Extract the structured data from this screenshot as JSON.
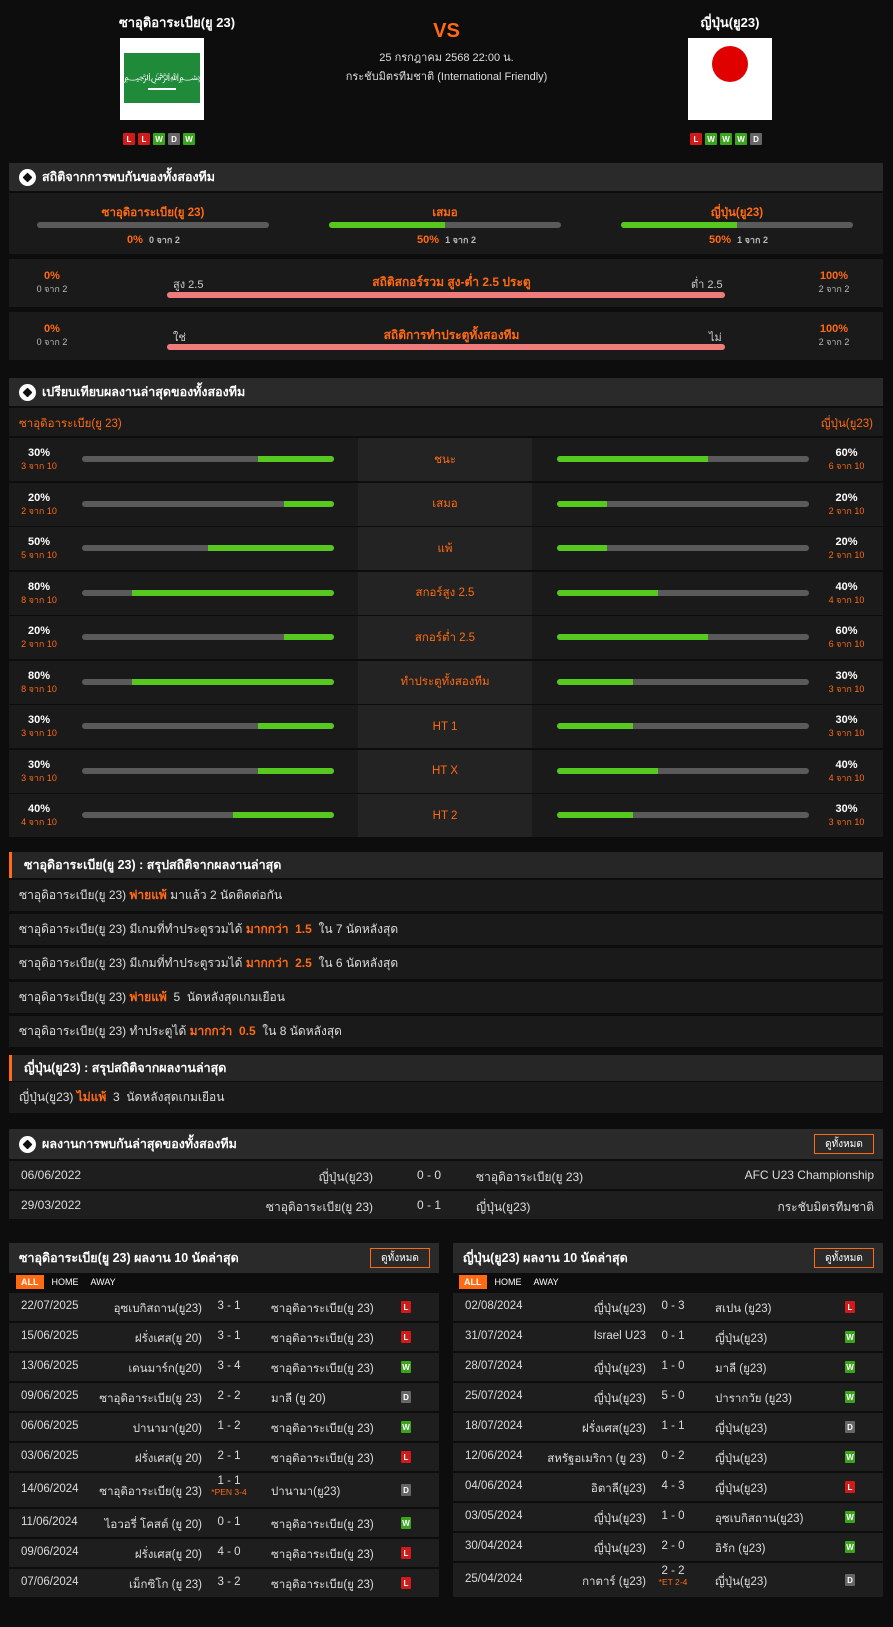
{
  "match": {
    "home_name": "ซาอุดิอาระเบีย(ยู 23)",
    "away_name": "ญี่ปุ่น(ยู23)",
    "vs": "VS",
    "date": "25 กรกฎาคม 2568 22:00 น.",
    "competition": "กระชับมิตรทีมชาติ (International Friendly)",
    "home_form": [
      "L",
      "L",
      "W",
      "D",
      "W"
    ],
    "away_form": [
      "L",
      "W",
      "W",
      "W",
      "D"
    ]
  },
  "h2h_stats": {
    "title": "สถิติจากการพบกันของทั้งสองทีม",
    "home": {
      "label": "ซาอุดิอาระเบีย(ยู 23)",
      "pct": "0%",
      "sub": "0 จาก 2",
      "value": 0
    },
    "draw": {
      "label": "เสมอ",
      "pct": "50%",
      "sub": "1 จาก 2",
      "value": 0.5
    },
    "away": {
      "label": "ญี่ปุ่น(ยู23)",
      "pct": "50%",
      "sub": "1 จาก 2",
      "value": 0.5
    },
    "ou": {
      "title": "สถิติสกอร์รวม สูง-ต่ำ 2.5 ประตู",
      "left_pct": "0%",
      "left_sub": "0 จาก 2",
      "left_label": "สูง 2.5",
      "right_label": "ต่ำ 2.5",
      "right_pct": "100%",
      "right_sub": "2 จาก 2"
    },
    "btts": {
      "title": "สถิติการทำประตูทั้งสองทีม",
      "left_pct": "0%",
      "left_sub": "0 จาก 2",
      "left_label": "ใช่",
      "right_label": "ไม่",
      "right_pct": "100%",
      "right_sub": "2 จาก 2"
    }
  },
  "compare": {
    "title": "เปรียบเทียบผลงานล่าสุดของทั้งสองทีม",
    "home_name": "ซาอุดิอาระเบีย(ยู 23)",
    "away_name": "ญี่ปุ่น(ยู23)",
    "rows": [
      {
        "label": "ชนะ",
        "hp": "30%",
        "hs": "3 จาก 10",
        "hv": 0.3,
        "ap": "60%",
        "as": "6 จาก 10",
        "av": 0.6
      },
      {
        "label": "เสมอ",
        "hp": "20%",
        "hs": "2 จาก 10",
        "hv": 0.2,
        "ap": "20%",
        "as": "2 จาก 10",
        "av": 0.2
      },
      {
        "label": "แพ้",
        "hp": "50%",
        "hs": "5 จาก 10",
        "hv": 0.5,
        "ap": "20%",
        "as": "2 จาก 10",
        "av": 0.2
      },
      {
        "label": "สกอร์สูง 2.5",
        "hp": "80%",
        "hs": "8 จาก 10",
        "hv": 0.8,
        "ap": "40%",
        "as": "4 จาก 10",
        "av": 0.4
      },
      {
        "label": "สกอร์ต่ำ 2.5",
        "hp": "20%",
        "hs": "2 จาก 10",
        "hv": 0.2,
        "ap": "60%",
        "as": "6 จาก 10",
        "av": 0.6
      },
      {
        "label": "ทำประตูทั้งสองทีม",
        "hp": "80%",
        "hs": "8 จาก 10",
        "hv": 0.8,
        "ap": "30%",
        "as": "3 จาก 10",
        "av": 0.3
      },
      {
        "label": "HT 1",
        "hp": "30%",
        "hs": "3 จาก 10",
        "hv": 0.3,
        "ap": "30%",
        "as": "3 จาก 10",
        "av": 0.3
      },
      {
        "label": "HT X",
        "hp": "30%",
        "hs": "3 จาก 10",
        "hv": 0.3,
        "ap": "40%",
        "as": "4 จาก 10",
        "av": 0.4
      },
      {
        "label": "HT 2",
        "hp": "40%",
        "hs": "4 จาก 10",
        "hv": 0.4,
        "ap": "30%",
        "as": "3 จาก 10",
        "av": 0.3
      }
    ]
  },
  "home_summary": {
    "title": "ซาอุดิอาระเบีย(ยู 23) : สรุปสถิติจากผลงานล่าสุด",
    "lines": [
      [
        {
          "t": "ซาอุดิอาระเบีย(ยู 23) "
        },
        {
          "t": "พ่ายแพ้",
          "o": 1
        },
        {
          "t": " มาแล้ว 2 นัดติดต่อกัน"
        }
      ],
      [
        {
          "t": "ซาอุดิอาระเบีย(ยู 23) มีเกมที่ทำประตูรวมได้ "
        },
        {
          "t": "มากกว่า  1.5",
          "o": 1
        },
        {
          "t": "  ใน 7 นัดหลังสุด"
        }
      ],
      [
        {
          "t": "ซาอุดิอาระเบีย(ยู 23) มีเกมที่ทำประตูรวมได้ "
        },
        {
          "t": "มากกว่า  2.5",
          "o": 1
        },
        {
          "t": "  ใน 6 นัดหลังสุด"
        }
      ],
      [
        {
          "t": "ซาอุดิอาระเบีย(ยู 23) "
        },
        {
          "t": "พ่ายแพ้",
          "o": 1
        },
        {
          "t": "  5  นัดหลังสุดเกมเยือน"
        }
      ],
      [
        {
          "t": "ซาอุดิอาระเบีย(ยู 23) ทำประตูได้ "
        },
        {
          "t": "มากกว่า  0.5",
          "o": 1
        },
        {
          "t": "  ใน 8 นัดหลังสุด"
        }
      ]
    ]
  },
  "away_summary": {
    "title": "ญี่ปุ่น(ยู23) : สรุปสถิติจากผลงานล่าสุด",
    "lines": [
      [
        {
          "t": "ญี่ปุ่น(ยู23) "
        },
        {
          "t": "ไม่แพ้",
          "o": 1
        },
        {
          "t": "  3  นัดหลังสุดเกมเยือน"
        }
      ]
    ]
  },
  "h2h": {
    "title": "ผลงานการพบกันล่าสุดของทั้งสองทีม",
    "view_all": "ดูทั้งหมด",
    "rows": [
      {
        "date": "06/06/2022",
        "home": "ญี่ปุ่น(ยู23)",
        "score": "0 - 0",
        "away": "ซาอุดิอาระเบีย(ยู 23)",
        "comp": "AFC U23 Championship"
      },
      {
        "date": "29/03/2022",
        "home": "ซาอุดิอาระเบีย(ยู 23)",
        "score": "0 - 1",
        "away": "ญี่ปุ่น(ยู23)",
        "comp": "กระชับมิตรทีมชาติ"
      }
    ]
  },
  "home_last10": {
    "title": "ซาอุดิอาระเบีย(ยู 23) ผลงาน 10 นัดล่าสุด",
    "view_all": "ดูทั้งหมด",
    "filters": [
      "ALL",
      "HOME",
      "AWAY"
    ],
    "rows": [
      {
        "date": "22/07/2025",
        "home": "อุซเบกิสถาน(ยู23)",
        "score": "3 - 1",
        "away": "ซาอุดิอาระเบีย(ยู 23)",
        "res": "L"
      },
      {
        "date": "15/06/2025",
        "home": "ฝรั่งเศส(ยู 20)",
        "score": "3 - 1",
        "away": "ซาอุดิอาระเบีย(ยู 23)",
        "res": "L"
      },
      {
        "date": "13/06/2025",
        "home": "เดนมาร์ก(ยู20)",
        "score": "3 - 4",
        "away": "ซาอุดิอาระเบีย(ยู 23)",
        "res": "W"
      },
      {
        "date": "09/06/2025",
        "home": "ซาอุดิอาระเบีย(ยู 23)",
        "score": "2 - 2",
        "away": "มาลี (ยู 20)",
        "res": "D"
      },
      {
        "date": "06/06/2025",
        "home": "ปานามา(ยู20)",
        "score": "1 - 2",
        "away": "ซาอุดิอาระเบีย(ยู 23)",
        "res": "W"
      },
      {
        "date": "03/06/2025",
        "home": "ฝรั่งเศส(ยู 20)",
        "score": "2 - 1",
        "away": "ซาอุดิอาระเบีย(ยู 23)",
        "res": "L"
      },
      {
        "date": "14/06/2024",
        "home": "ซาอุดิอาระเบีย(ยู 23)",
        "score": "1 - 1",
        "note": "*PEN 3-4",
        "away": "ปานามา(ยู23)",
        "res": "D"
      },
      {
        "date": "11/06/2024",
        "home": "ไอวอรี่ โคสต์ (ยู 20)",
        "score": "0 - 1",
        "away": "ซาอุดิอาระเบีย(ยู 23)",
        "res": "W"
      },
      {
        "date": "09/06/2024",
        "home": "ฝรั่งเศส(ยู 20)",
        "score": "4 - 0",
        "away": "ซาอุดิอาระเบีย(ยู 23)",
        "res": "L"
      },
      {
        "date": "07/06/2024",
        "home": "เม็กซิโก (ยู 23)",
        "score": "3 - 2",
        "away": "ซาอุดิอาระเบีย(ยู 23)",
        "res": "L"
      }
    ]
  },
  "away_last10": {
    "title": "ญี่ปุ่น(ยู23) ผลงาน 10 นัดล่าสุด",
    "view_all": "ดูทั้งหมด",
    "filters": [
      "ALL",
      "HOME",
      "AWAY"
    ],
    "rows": [
      {
        "date": "02/08/2024",
        "home": "ญี่ปุ่น(ยู23)",
        "score": "0 - 3",
        "away": "สเปน (ยู23)",
        "res": "L"
      },
      {
        "date": "31/07/2024",
        "home": "Israel U23",
        "score": "0 - 1",
        "away": "ญี่ปุ่น(ยู23)",
        "res": "W"
      },
      {
        "date": "28/07/2024",
        "home": "ญี่ปุ่น(ยู23)",
        "score": "1 - 0",
        "away": "มาลี (ยู23)",
        "res": "W"
      },
      {
        "date": "25/07/2024",
        "home": "ญี่ปุ่น(ยู23)",
        "score": "5 - 0",
        "away": "ปารากวัย (ยู23)",
        "res": "W"
      },
      {
        "date": "18/07/2024",
        "home": "ฝรั่งเศส(ยู23)",
        "score": "1 - 1",
        "away": "ญี่ปุ่น(ยู23)",
        "res": "D"
      },
      {
        "date": "12/06/2024",
        "home": "สหรัฐอเมริกา (ยู 23)",
        "score": "0 - 2",
        "away": "ญี่ปุ่น(ยู23)",
        "res": "W"
      },
      {
        "date": "04/06/2024",
        "home": "อิตาลี(ยู23)",
        "score": "4 - 3",
        "away": "ญี่ปุ่น(ยู23)",
        "res": "L"
      },
      {
        "date": "03/05/2024",
        "home": "ญี่ปุ่น(ยู23)",
        "score": "1 - 0",
        "away": "อุซเบกิสถาน(ยู23)",
        "res": "W"
      },
      {
        "date": "30/04/2024",
        "home": "ญี่ปุ่น(ยู23)",
        "score": "2 - 0",
        "away": "อิรัก (ยู23)",
        "res": "W"
      },
      {
        "date": "25/04/2024",
        "home": "กาตาร์ (ยู23)",
        "score": "2 - 2",
        "note": "*ET 2-4",
        "away": "ญี่ปุ่น(ยู23)",
        "res": "D"
      }
    ]
  },
  "colors": {
    "accent": "#ff6a13",
    "green": "#56c81e",
    "red": "#f07b7b",
    "bg": "#0d0d0d",
    "panel": "#1a1a1a"
  }
}
